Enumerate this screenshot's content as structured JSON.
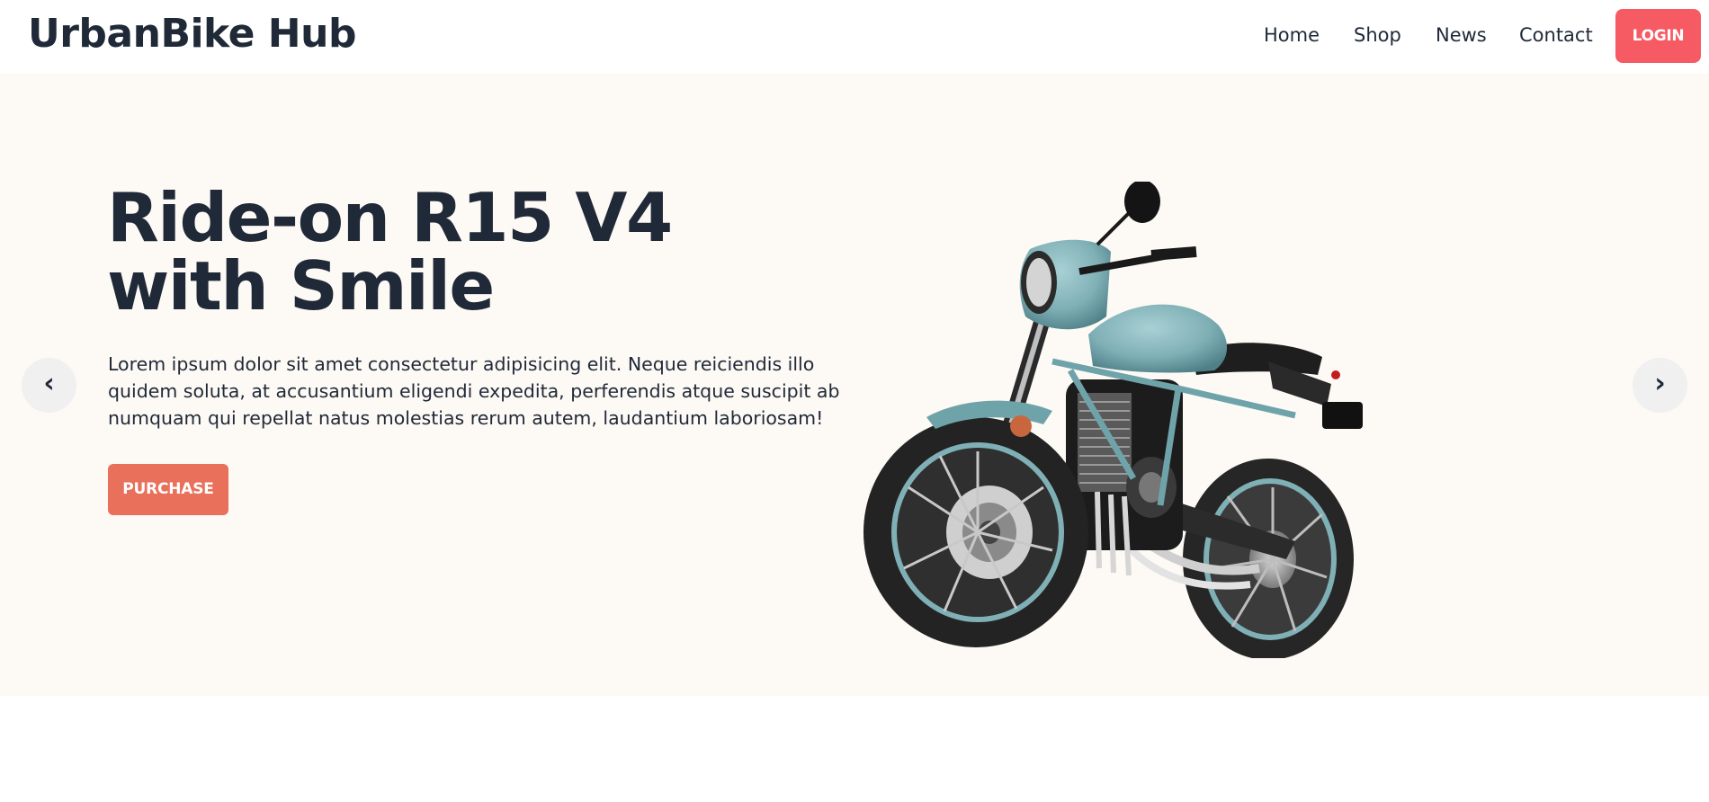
{
  "header": {
    "brand": "UrbanBike Hub",
    "nav": [
      {
        "label": "Home"
      },
      {
        "label": "Shop"
      },
      {
        "label": "News"
      },
      {
        "label": "Contact"
      }
    ],
    "login_label": "LOGIN"
  },
  "hero": {
    "title_line1": "Ride-on R15 V4",
    "title_line2": "with Smile",
    "description": "Lorem ipsum dolor sit amet consectetur adipisicing elit. Neque reiciendis illo quidem soluta, at accusantium eligendi expedita, perferendis atque suscipit ab numquam qui repellat natus molestias rerum autem, laudantium laboriosam!",
    "purchase_label": "PURCHASE",
    "prev_icon": "‹",
    "next_icon": "›"
  },
  "colors": {
    "login_bg": "#f65a63",
    "purchase_bg": "#e9705a",
    "hero_bg": "#fdf9f5",
    "text_dark": "#1f2937",
    "bike_body": "#7fb0b6"
  }
}
